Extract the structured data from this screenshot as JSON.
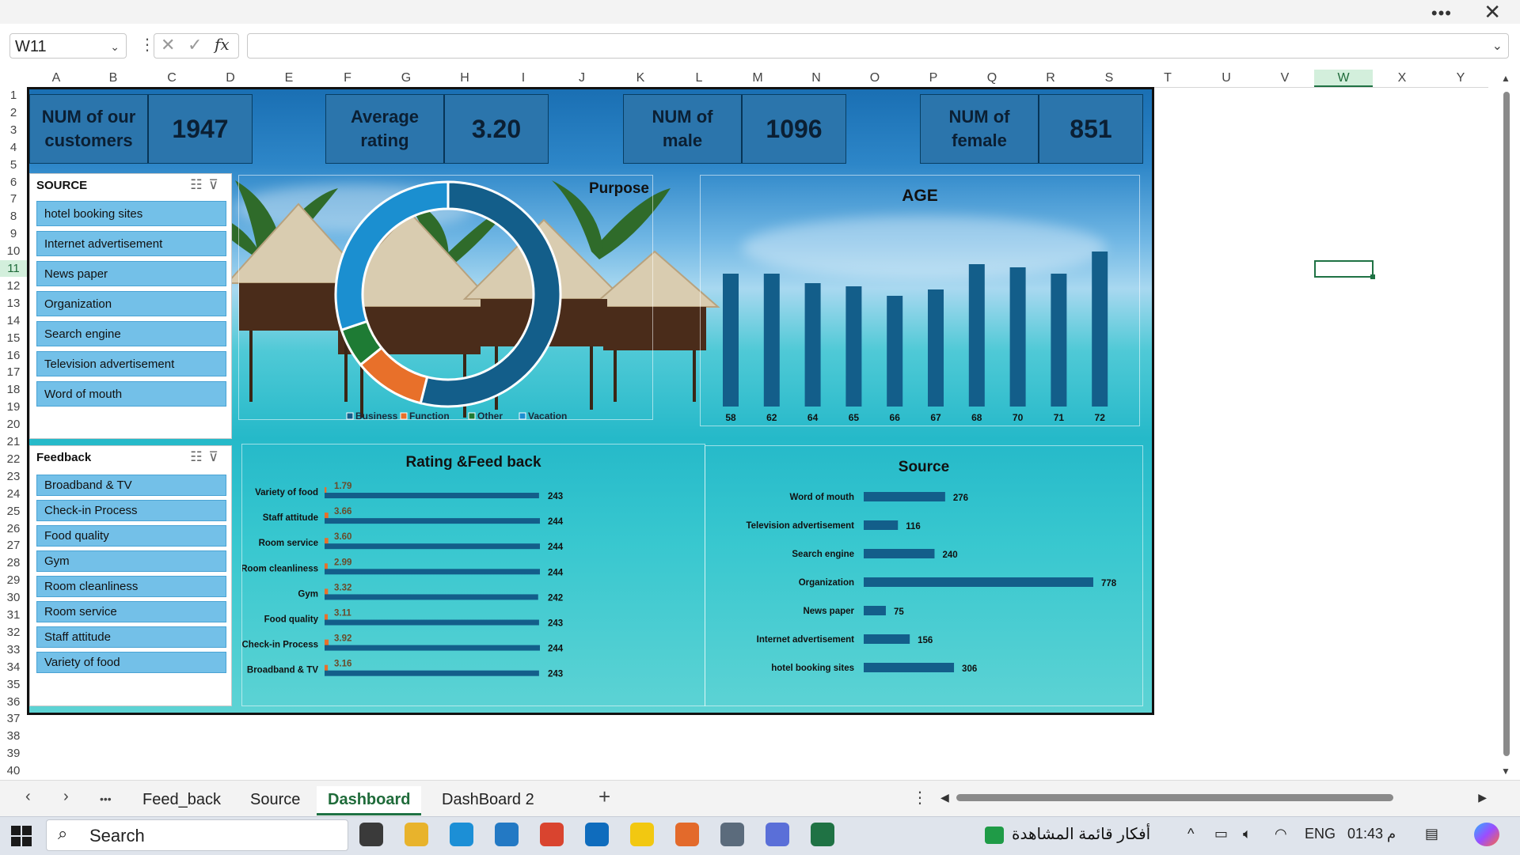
{
  "window": {
    "more_icon": "more-horizontal-icon",
    "close_glyph": "✕"
  },
  "formula_bar": {
    "name_box": "W11",
    "fx": "fx",
    "cancel_glyph": "✕",
    "enter_glyph": "✓",
    "formula": ""
  },
  "columns": [
    "A",
    "B",
    "C",
    "D",
    "E",
    "F",
    "G",
    "H",
    "I",
    "J",
    "K",
    "L",
    "M",
    "N",
    "O",
    "P",
    "Q",
    "R",
    "S",
    "T",
    "U",
    "V",
    "W",
    "X",
    "Y"
  ],
  "selected_column": "W",
  "rows": [
    "1",
    "2",
    "3",
    "4",
    "5",
    "6",
    "7",
    "8",
    "9",
    "10",
    "11",
    "12",
    "13",
    "14",
    "15",
    "16",
    "17",
    "18",
    "19",
    "20",
    "21",
    "22",
    "23",
    "24",
    "25",
    "26",
    "27",
    "28",
    "29",
    "30",
    "31",
    "32",
    "33",
    "34",
    "35",
    "36",
    "37",
    "38",
    "39",
    "40"
  ],
  "selected_row": "11",
  "kpis": [
    {
      "label_line1": "NUM of our",
      "label_line2": "customers",
      "value": "1947"
    },
    {
      "label_line1": "Average",
      "label_line2": "rating",
      "value": "3.20"
    },
    {
      "label_line1": "NUM of",
      "label_line2": "male",
      "value": "1096"
    },
    {
      "label_line1": "NUM of",
      "label_line2": "female",
      "value": "851"
    }
  ],
  "source_slicer": {
    "title": "SOURCE",
    "items": [
      "hotel booking sites",
      "Internet advertisement",
      "News paper",
      "Organization",
      "Search engine",
      "Television advertisement",
      "Word of mouth"
    ]
  },
  "feedback_slicer": {
    "title": "Feedback",
    "items": [
      "Broadband & TV",
      "Check-in Process",
      "Food quality",
      "Gym",
      "Room cleanliness",
      "Room service",
      "Staff attitude",
      "Variety of food"
    ]
  },
  "colors": {
    "accent_dark": "#135e8a",
    "donut_light": "#1b8fd0",
    "donut_orange": "#e8702a",
    "donut_green": "#1e7b34",
    "excel_green": "#1f7244"
  },
  "chart_data": [
    {
      "type": "pie",
      "title": "Purpose",
      "donut": true,
      "legend": "bottom",
      "categories": [
        "Business",
        "Function",
        "Other",
        "Vacation"
      ],
      "values": [
        1050,
        200,
        110,
        587
      ],
      "series_colors": [
        "#135e8a",
        "#e8702a",
        "#1e7b34",
        "#1b8fd0"
      ]
    },
    {
      "type": "bar",
      "title": "AGE",
      "categories": [
        "58",
        "62",
        "64",
        "65",
        "66",
        "67",
        "68",
        "70",
        "71",
        "72"
      ],
      "values": [
        42,
        42,
        39,
        38,
        35,
        37,
        45,
        44,
        42,
        49
      ],
      "ylim": [
        0,
        55
      ],
      "grid": false
    },
    {
      "type": "bar",
      "orientation": "horizontal",
      "title": "Rating &Feed back",
      "categories": [
        "Variety of food",
        "Staff attitude",
        "Room service",
        "Room cleanliness",
        "Gym",
        "Food quality",
        "Check-in Process",
        "Broadband & TV"
      ],
      "series": [
        {
          "values": [
            1.79,
            3.66,
            3.6,
            2.99,
            3.32,
            3.11,
            3.92,
            3.16
          ]
        },
        {
          "values": [
            243,
            244,
            244,
            244,
            242,
            243,
            244,
            243
          ]
        }
      ]
    },
    {
      "type": "bar",
      "orientation": "horizontal",
      "title": "Source",
      "categories": [
        "Word of mouth",
        "Television advertisement",
        "Search engine",
        "Organization",
        "News paper",
        "Internet advertisement",
        "hotel booking sites"
      ],
      "values": [
        276,
        116,
        240,
        778,
        75,
        156,
        306
      ],
      "xlim": [
        0,
        800
      ]
    }
  ],
  "sheet_tabs": [
    {
      "label": "Feed_back",
      "active": false
    },
    {
      "label": "Source",
      "active": false
    },
    {
      "label": "Dashboard",
      "active": true
    },
    {
      "label": "DashBoard 2",
      "active": false
    }
  ],
  "tab_nav": {
    "prev": "‹",
    "next": "›",
    "more": "•••",
    "add": "+",
    "options": "⋮"
  },
  "taskbar": {
    "search_label": "Search",
    "widget_text": "أفكار قائمة المشاهدة",
    "lang": "ENG",
    "time": "01:43 م",
    "apps": [
      "task-view-icon",
      "file-explorer-icon",
      "edge-icon",
      "vscode-icon",
      "chrome-icon",
      "outlook-icon",
      "power-bi-icon",
      "photos-icon",
      "settings-icon",
      "snipping-tool-icon",
      "excel-icon"
    ]
  }
}
